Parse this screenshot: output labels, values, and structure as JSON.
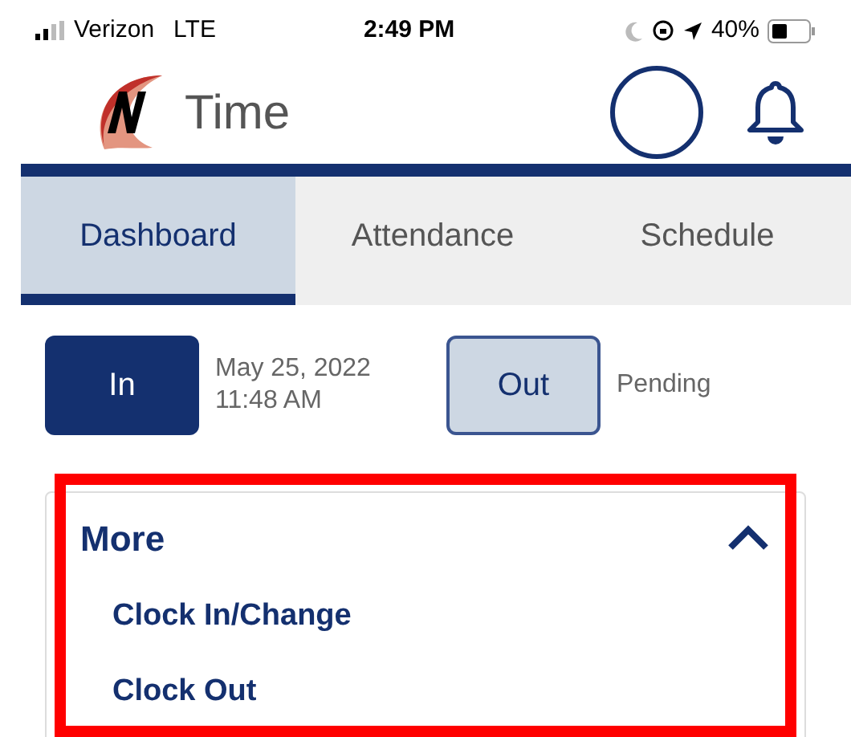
{
  "status_bar": {
    "carrier": "Verizon",
    "network": "LTE",
    "time": "2:49 PM",
    "battery": "40%"
  },
  "header": {
    "app_name": "Time"
  },
  "tabs": [
    {
      "label": "Dashboard",
      "selected": true
    },
    {
      "label": "Attendance",
      "selected": false
    },
    {
      "label": "Schedule",
      "selected": false
    }
  ],
  "punches": [
    {
      "label": "In",
      "selected": true,
      "detail_lines": [
        "May 25, 2022",
        "11:48 AM"
      ]
    },
    {
      "label": "Out",
      "selected": false,
      "detail_lines": [
        "Pending"
      ]
    }
  ],
  "more": {
    "title": "More",
    "expanded": true,
    "items": [
      "Clock In/Change",
      "Clock Out"
    ]
  },
  "highlight": {
    "on": true
  }
}
